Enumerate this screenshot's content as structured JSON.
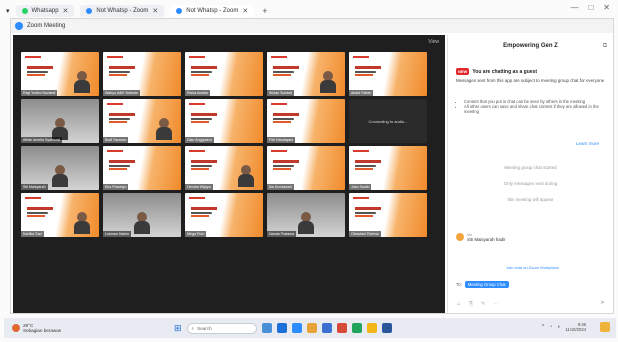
{
  "browser": {
    "tabs": [
      {
        "label": "Whatsapp"
      },
      {
        "label": "Not Whatsp - Zoom"
      },
      {
        "label": "Not Whatsp - Zoom"
      }
    ],
    "newtab": "+",
    "controls": [
      "—",
      "□",
      "✕"
    ]
  },
  "zoom": {
    "window_title": "Zoom Meeting",
    "view_label": "View",
    "tiles": [
      {
        "style": "slide",
        "name": "Rayi Yudho Novianti"
      },
      {
        "style": "slide",
        "name": "Wahyu Adhi Yulianto"
      },
      {
        "style": "slide",
        "name": "Rizka Amalia"
      },
      {
        "style": "slide",
        "name": "Wulan Sumiati"
      },
      {
        "style": "slide",
        "name": "Abdul Fattah"
      },
      {
        "style": "photo",
        "name": "Afifah Amelia Syahrizal"
      },
      {
        "style": "slide",
        "name": "Budi Santoso"
      },
      {
        "style": "slide",
        "name": "Dian Anggraeni"
      },
      {
        "style": "slide",
        "name": "Fitri Handayani"
      },
      {
        "style": "dark",
        "name": "",
        "text": "Connecting to audio..."
      },
      {
        "style": "photo",
        "name": "Siti Maisyarah"
      },
      {
        "style": "slide",
        "name": "Eko Prasetyo"
      },
      {
        "style": "slide",
        "name": "Hendra Wijaya"
      },
      {
        "style": "slide",
        "name": "Ika Kurniawati"
      },
      {
        "style": "slide",
        "name": "Joko Susilo"
      },
      {
        "style": "slide",
        "name": "Kartika Sari"
      },
      {
        "style": "photo",
        "name": "Lukman Hakim"
      },
      {
        "style": "slide",
        "name": "Mega Putri"
      },
      {
        "style": "photo",
        "name": "Nanda Pratama"
      },
      {
        "style": "slide",
        "name": "Oktaviani Rahma"
      }
    ]
  },
  "chat": {
    "title": "Empowering Gen Z",
    "new_badge": "NEW",
    "guest_heading": "You are chatting as a guest",
    "guest_text": "Messages sent from this app are subject to meeting group chat for everyone",
    "bullets": [
      "Content that you put in chat can be seen by others in the meeting",
      "All other users can save and share chat content if they are allowed in the meeting"
    ],
    "learn_more": "Learn more",
    "system_lines": [
      "Meeting group chat started",
      "Only messages sent during",
      "this meeting will appear"
    ],
    "message": {
      "sender": "Me",
      "text": "Siti Maisyarah hadir"
    },
    "reply": "Join chat on Zoom Workplace",
    "to_label": "To:",
    "to_value": "Meeting Group Chat",
    "tools": [
      "☺",
      "⎘",
      "✎",
      "⋯"
    ],
    "send_icon": "➤"
  },
  "taskbar": {
    "weather_temp": "29°C",
    "weather_desc": "Sebagian berawan",
    "search_placeholder": "Search",
    "time": "9:46",
    "date": "11/10/2024"
  },
  "colors": {
    "zoom_blue": "#2d8cff",
    "slide_orange": "#f08a2b",
    "stage_bg": "#1f1f1f"
  }
}
